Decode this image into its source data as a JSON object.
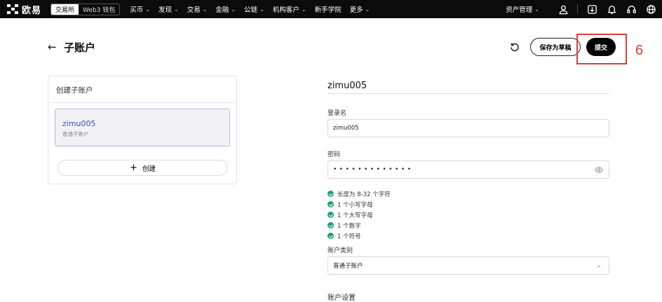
{
  "nav": {
    "brand": "欧易",
    "segments": [
      "交易所",
      "Web3 钱包"
    ],
    "menu": [
      {
        "label": "买币",
        "dropdown": true
      },
      {
        "label": "发现",
        "dropdown": true
      },
      {
        "label": "交易",
        "dropdown": true
      },
      {
        "label": "金融",
        "dropdown": true
      },
      {
        "label": "公链",
        "dropdown": true
      },
      {
        "label": "机构客户",
        "dropdown": true
      },
      {
        "label": "新手学院",
        "dropdown": false
      },
      {
        "label": "更多",
        "dropdown": true
      }
    ],
    "asset_management": "资产管理",
    "chevron": "⌄"
  },
  "header": {
    "back_arrow": "←",
    "title": "子账户",
    "draft_label": "保存为草稿",
    "submit_label": "提交",
    "step_number": "6"
  },
  "left_card": {
    "title": "创建子账户",
    "account": {
      "name": "zimu005",
      "type": "普通子账户"
    },
    "create_plus": "+",
    "create_label": "创建"
  },
  "form": {
    "title": "zimu005",
    "login_label": "登录名",
    "login_value": "zimu005",
    "password_label": "密码",
    "password_mask": "•••••••••••••",
    "rules": [
      "长度为 8-32 个字符",
      "1 个小写字母",
      "1 个大写字母",
      "1 个数字",
      "1 个符号"
    ],
    "account_type_label": "账户类别",
    "account_type_value": "普通子账户",
    "next_section_partial": "账户设置"
  },
  "colors": {
    "nav_bg": "#0b0b0b",
    "highlight": "#e23b3b",
    "rule_check": "#20a06b",
    "account_name": "#3b4fb5"
  }
}
